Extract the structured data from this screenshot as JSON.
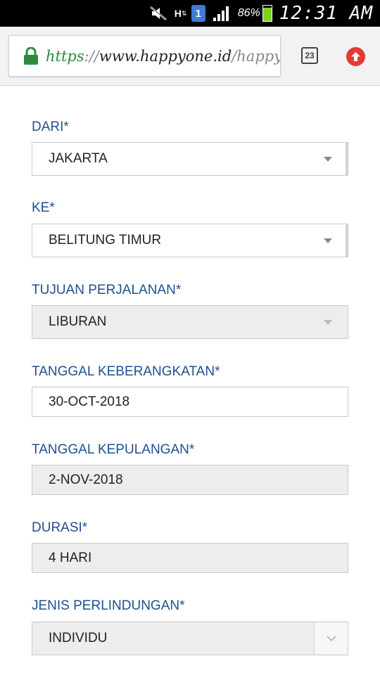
{
  "status_bar": {
    "notification_count": "1",
    "network_label": "H",
    "battery_percent": "86%",
    "battery_level": 0.86,
    "time": "12:31 AM",
    "icons": [
      "mute-icon",
      "network-h-icon",
      "notification-icon",
      "signal-icon",
      "battery-icon"
    ]
  },
  "browser": {
    "url_scheme": "https",
    "url_sep": "://",
    "url_host": "www.happyone.id",
    "url_path": "/happy",
    "tab_count": "23",
    "colors": {
      "secure": "#2e8a3e",
      "upload": "#e53935"
    }
  },
  "form": {
    "fields": [
      {
        "label": "DARI*",
        "value": "JAKARTA",
        "type": "select",
        "disabled": false
      },
      {
        "label": "KE*",
        "value": "BELITUNG TIMUR",
        "type": "select",
        "disabled": false
      },
      {
        "label": "TUJUAN PERJALANAN*",
        "value": "LIBURAN",
        "type": "select",
        "disabled": true
      },
      {
        "label": "TANGGAL KEBERANGKATAN*",
        "value": "30-OCT-2018",
        "type": "text",
        "disabled": false
      },
      {
        "label": "TANGGAL KEPULANGAN*",
        "value": "2-NOV-2018",
        "type": "text",
        "disabled": true
      },
      {
        "label": "DURASI*",
        "value": "4 HARI",
        "type": "text",
        "disabled": true
      },
      {
        "label": "JENIS PERLINDUNGAN*",
        "value": "INDIVIDU",
        "type": "select",
        "disabled": true
      }
    ],
    "label_color": "#1f4f8f"
  }
}
